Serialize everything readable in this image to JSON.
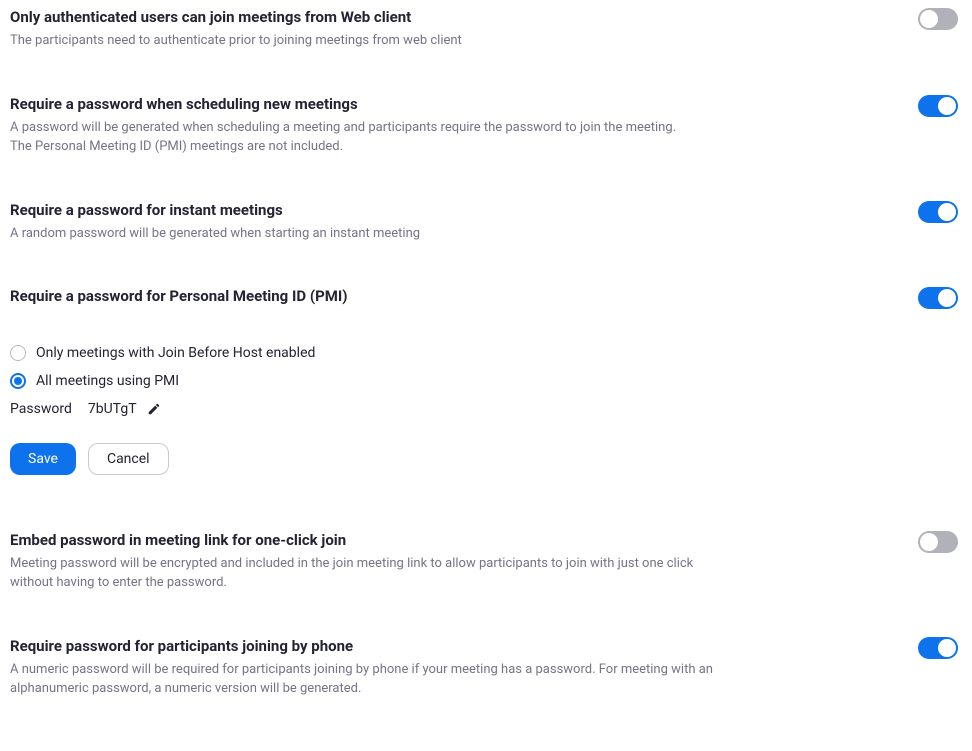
{
  "settings": {
    "auth": {
      "title": "Only authenticated users can join meetings from Web client",
      "desc": "The participants need to authenticate prior to joining meetings from web client",
      "enabled": false
    },
    "pwSchedule": {
      "title": "Require a password when scheduling new meetings",
      "desc1": "A password will be generated when scheduling a meeting and participants require the password to join the meeting.",
      "desc2": "The Personal Meeting ID (PMI) meetings are not included.",
      "enabled": true
    },
    "pwInstant": {
      "title": "Require a password for instant meetings",
      "desc": "A random password will be generated when starting an instant meeting",
      "enabled": true
    },
    "pwPmi": {
      "title": "Require a password for Personal Meeting ID (PMI)",
      "enabled": true,
      "radio1": "Only meetings with Join Before Host enabled",
      "radio2": "All meetings using PMI",
      "selected": "all",
      "pwLabel": "Password",
      "pwValue": "7bUTgT",
      "saveLabel": "Save",
      "cancelLabel": "Cancel"
    },
    "embed": {
      "title": "Embed password in meeting link for one-click join",
      "desc": "Meeting password will be encrypted and included in the join meeting link to allow participants to join with just one click without having to enter the password.",
      "enabled": false
    },
    "phone": {
      "title": "Require password for participants joining by phone",
      "desc": "A numeric password will be required for participants joining by phone if your meeting has a password. For meeting with an alphanumeric password, a numeric version will be generated.",
      "enabled": true
    }
  }
}
